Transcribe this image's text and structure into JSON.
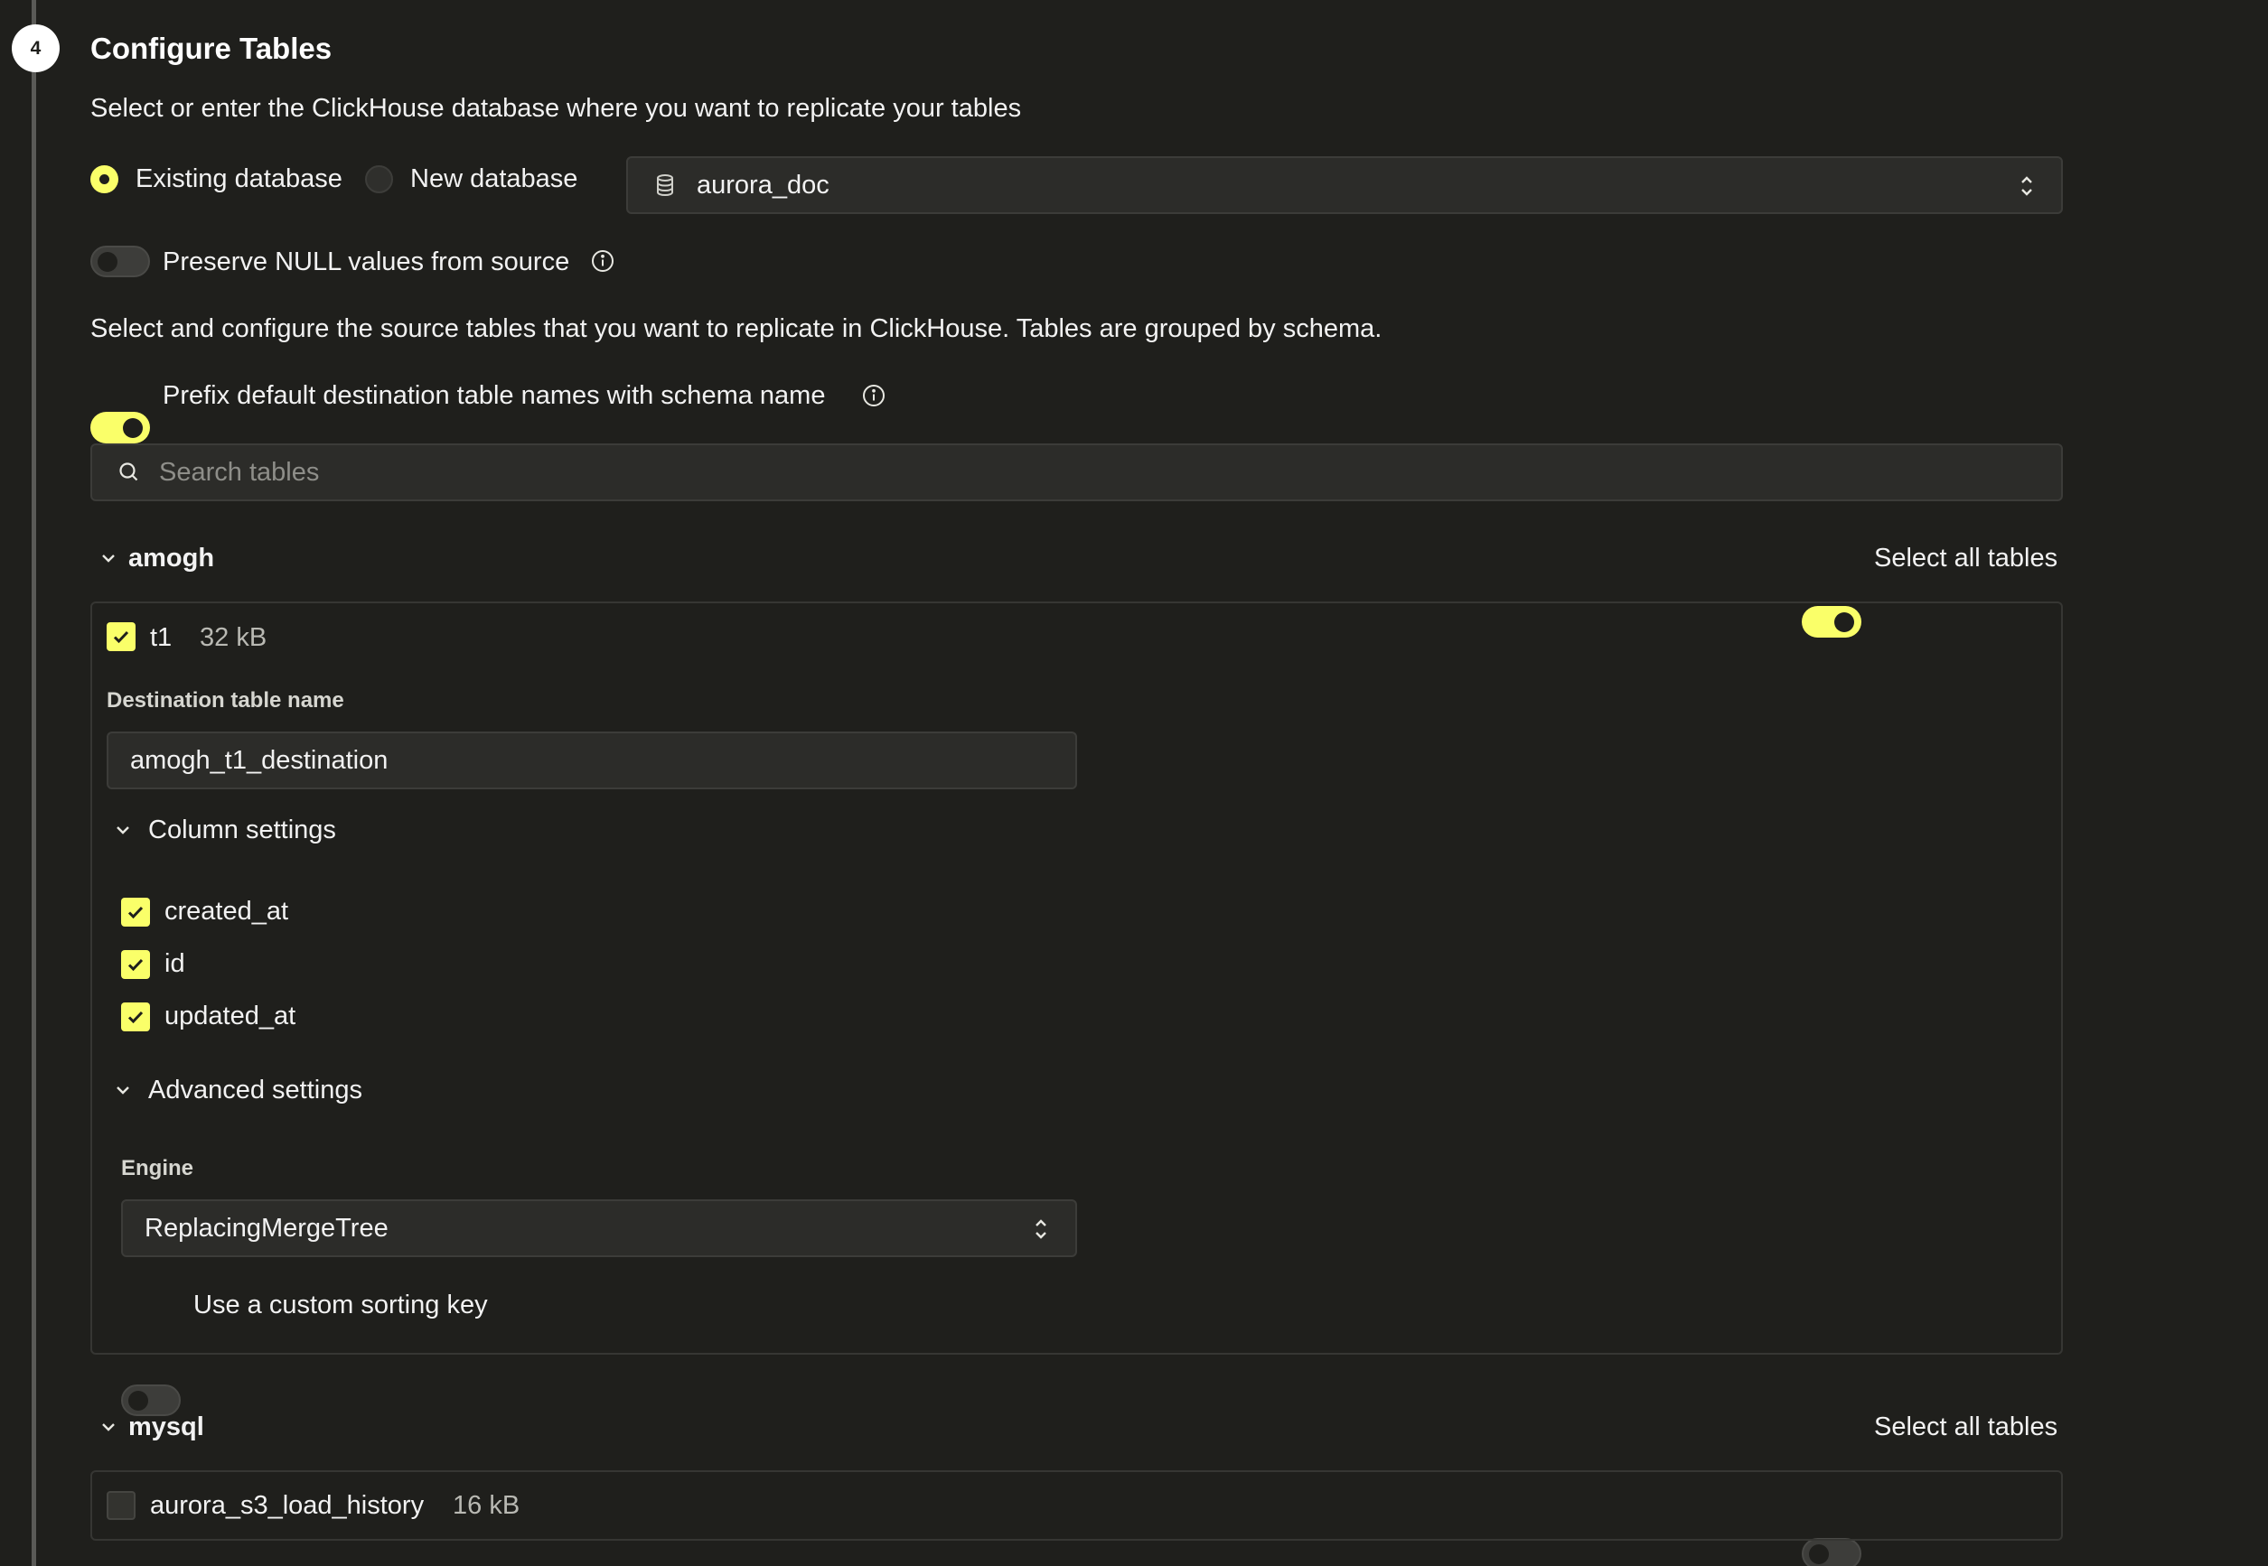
{
  "step": {
    "number": "4",
    "title": "Configure Tables"
  },
  "database": {
    "description": "Select or enter the ClickHouse database where you want to replicate your tables",
    "existing_label": "Existing database",
    "new_label": "New database",
    "selected": "aurora_doc"
  },
  "preserve_null": {
    "label": "Preserve NULL values from source",
    "enabled": false
  },
  "tables_description": "Select and configure the source tables that you want to replicate in ClickHouse. Tables are grouped by schema.",
  "prefix_toggle": {
    "label": "Prefix default destination table names with schema name",
    "enabled": true
  },
  "search": {
    "placeholder": "Search tables"
  },
  "schemas": [
    {
      "name": "amogh",
      "select_all_label": "Select all tables",
      "select_all": true,
      "tables": [
        {
          "name": "t1",
          "size": "32 kB",
          "checked": true,
          "destination_label": "Destination table name",
          "destination_value": "amogh_t1_destination",
          "column_settings_label": "Column settings",
          "columns": [
            {
              "name": "created_at",
              "checked": true
            },
            {
              "name": "id",
              "checked": true
            },
            {
              "name": "updated_at",
              "checked": true
            }
          ],
          "advanced_label": "Advanced settings",
          "engine_label": "Engine",
          "engine_value": "ReplacingMergeTree",
          "custom_sort_label": "Use a custom sorting key",
          "custom_sort": false
        }
      ]
    },
    {
      "name": "mysql",
      "select_all_label": "Select all tables",
      "select_all": false,
      "tables": [
        {
          "name": "aurora_s3_load_history",
          "size": "16 kB",
          "checked": false
        }
      ]
    }
  ],
  "colors": {
    "accent": "#faff69",
    "background": "#1f1f1c",
    "field": "#2c2c29"
  }
}
